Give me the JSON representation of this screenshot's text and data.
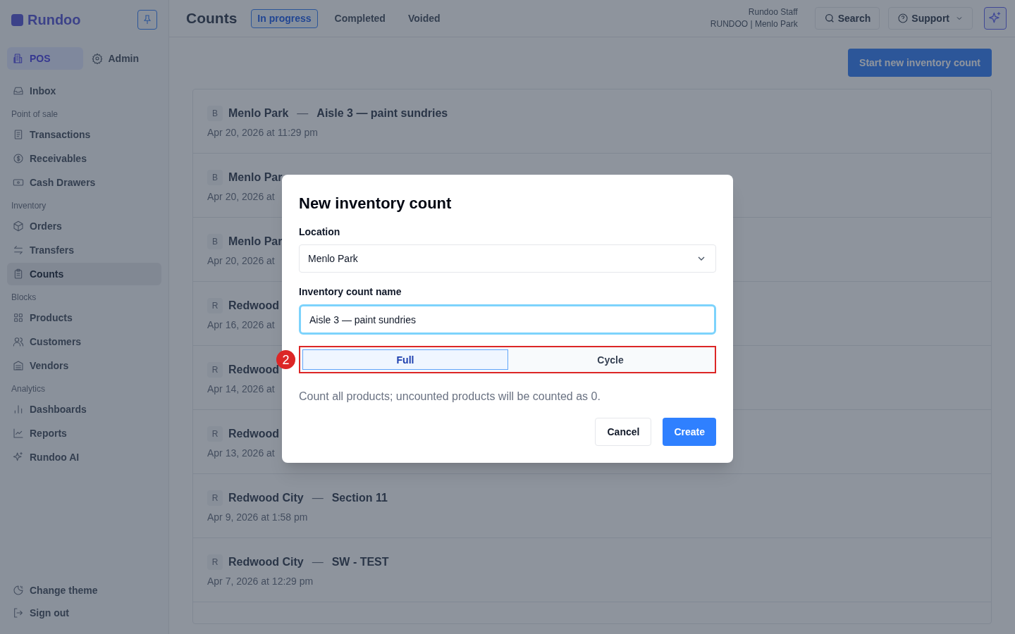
{
  "brand": {
    "name": "Rundoo"
  },
  "modes": [
    {
      "label": "POS",
      "selected": true
    },
    {
      "label": "Admin",
      "selected": false
    }
  ],
  "sidebar": {
    "items": [
      {
        "kind": "item",
        "label": "Inbox",
        "selected": false
      },
      {
        "kind": "section",
        "label": "Point of sale"
      },
      {
        "kind": "item",
        "label": "Transactions",
        "selected": false
      },
      {
        "kind": "item",
        "label": "Receivables",
        "selected": false
      },
      {
        "kind": "item",
        "label": "Cash Drawers",
        "selected": false
      },
      {
        "kind": "section",
        "label": "Inventory"
      },
      {
        "kind": "item",
        "label": "Orders",
        "selected": false
      },
      {
        "kind": "item",
        "label": "Transfers",
        "selected": false
      },
      {
        "kind": "item",
        "label": "Counts",
        "selected": true
      },
      {
        "kind": "section",
        "label": "Blocks"
      },
      {
        "kind": "item",
        "label": "Products",
        "selected": false
      },
      {
        "kind": "item",
        "label": "Customers",
        "selected": false
      },
      {
        "kind": "item",
        "label": "Vendors",
        "selected": false
      },
      {
        "kind": "section",
        "label": "Analytics"
      },
      {
        "kind": "item",
        "label": "Dashboards",
        "selected": false
      },
      {
        "kind": "item",
        "label": "Reports",
        "selected": false
      },
      {
        "kind": "item",
        "label": "Rundoo AI",
        "selected": false
      }
    ],
    "footer": [
      {
        "label": "Change theme"
      },
      {
        "label": "Sign out"
      }
    ]
  },
  "header": {
    "title": "Counts",
    "tabs": [
      {
        "label": "In progress",
        "selected": true
      },
      {
        "label": "Completed",
        "selected": false
      },
      {
        "label": "Voided",
        "selected": false
      }
    ],
    "user": {
      "name": "Rundoo Staff",
      "store": "RUNDOO | Menlo Park"
    },
    "search_button": "Search",
    "support_button": "Support"
  },
  "primary_action": "Start new inventory count",
  "counts": [
    {
      "badge": "B",
      "location": "Menlo Park",
      "separator": "—",
      "name": "Aisle 3 — paint sundries",
      "date": "Apr 20, 2026 at 11:29 pm"
    },
    {
      "badge": "B",
      "location": "Menlo Par",
      "date": "Apr 20, 2026 at"
    },
    {
      "badge": "B",
      "location": "Menlo Par",
      "date": "Apr 20, 2026 at"
    },
    {
      "badge": "R",
      "location": "Redwood",
      "date": "Apr 16, 2026 at"
    },
    {
      "badge": "R",
      "location": "Redwood",
      "date": "Apr 14, 2026 at"
    },
    {
      "badge": "R",
      "location": "Redwood",
      "date": "Apr 13, 2026 at"
    },
    {
      "badge": "R",
      "location": "Redwood City",
      "separator": "—",
      "name": "Section 11",
      "date": "Apr 9, 2026 at 1:58 pm"
    },
    {
      "badge": "R",
      "location": "Redwood City",
      "separator": "—",
      "name": "SW - TEST",
      "date": "Apr 7, 2026 at 12:29 pm"
    }
  ],
  "dialog": {
    "title": "New inventory count",
    "location_label": "Location",
    "location_value": "Menlo Park",
    "name_label": "Inventory count name",
    "name_value": "Aisle 3 — paint sundries",
    "count_types": [
      {
        "label": "Full",
        "selected": true
      },
      {
        "label": "Cycle",
        "selected": false
      }
    ],
    "description": "Count all products; uncounted products will be counted as 0.",
    "buttons": [
      {
        "kind": "secondary",
        "label": "Cancel"
      },
      {
        "kind": "primary",
        "label": "Create"
      }
    ],
    "annotation": {
      "label": "2"
    }
  }
}
